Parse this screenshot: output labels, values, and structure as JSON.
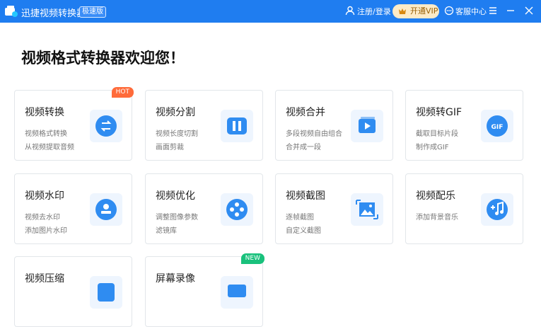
{
  "titlebar": {
    "app_title": "迅捷视频转换器",
    "badge": "极速版",
    "login": "注册/登录",
    "vip": "开通VIP",
    "service": "客服中心"
  },
  "main": {
    "heading": "视频格式转换器欢迎您！",
    "cards": [
      {
        "title": "视频转换",
        "line1": "视频格式转换",
        "line2": "从视频提取音频",
        "tag": "HOT",
        "icon": "swap-arrows-icon"
      },
      {
        "title": "视频分割",
        "line1": "视频长度切割",
        "line2": "画面剪裁",
        "icon": "split-icon"
      },
      {
        "title": "视频合并",
        "line1": "多段视频自由组合",
        "line2": "合并成一段",
        "icon": "merge-play-icon"
      },
      {
        "title": "视频转GIF",
        "line1": "截取目标片段",
        "line2": "制作成GIF",
        "icon": "gif-icon"
      },
      {
        "title": "视频水印",
        "line1": "视频去水印",
        "line2": "添加图片水印",
        "icon": "stamp-icon"
      },
      {
        "title": "视频优化",
        "line1": "调整图像参数",
        "line2": "滤镜库",
        "icon": "film-reel-icon"
      },
      {
        "title": "视频截图",
        "line1": "逐帧截图",
        "line2": "自定义截图",
        "icon": "image-crop-icon"
      },
      {
        "title": "视频配乐",
        "line1": "添加背景音乐",
        "line2": "",
        "icon": "music-add-icon"
      },
      {
        "title": "视频压缩",
        "line1": "",
        "line2": "",
        "icon": "compress-icon"
      },
      {
        "title": "屏幕录像",
        "line1": "",
        "line2": "",
        "tag": "NEW",
        "icon": "screen-record-icon"
      }
    ]
  },
  "colors": {
    "accent": "#1f7df0",
    "hot": "#ff6b3a",
    "new": "#19c17c"
  }
}
